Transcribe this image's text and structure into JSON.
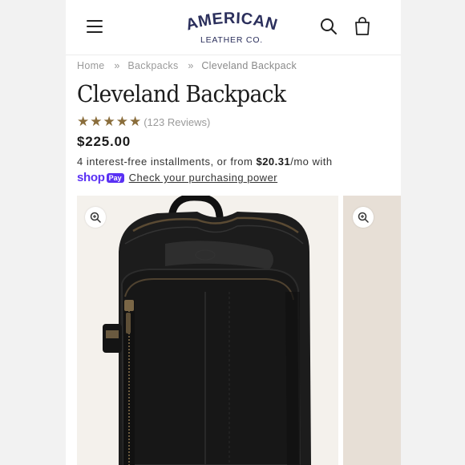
{
  "brand": {
    "logo_line1": "AMERICAN",
    "logo_line2": "LEATHER CO."
  },
  "header": {
    "menu_icon": "hamburger-icon",
    "search_icon": "search-icon",
    "cart_icon": "cart-icon"
  },
  "breadcrumb": {
    "home": "Home",
    "sep": "»",
    "category": "Backpacks",
    "current": "Cleveland Backpack"
  },
  "product": {
    "title": "Cleveland Backpack",
    "stars": "★★★★★",
    "rating": 5,
    "reviews": "(123 Reviews)",
    "price": "$225.00"
  },
  "installments": {
    "text_before": "4 interest-free installments, or from ",
    "amount": "$20.31",
    "text_after": "/mo with"
  },
  "shoppay": {
    "shop": "shop",
    "pay": "Pay",
    "link": "Check your purchasing power"
  },
  "gallery": {
    "zoom_icon": "zoom-in-icon"
  },
  "colors": {
    "star": "#8a6d3b",
    "shop_pay": "#5a31f4",
    "logo": "#2b2f5c",
    "leather": "#1a1a1a"
  }
}
